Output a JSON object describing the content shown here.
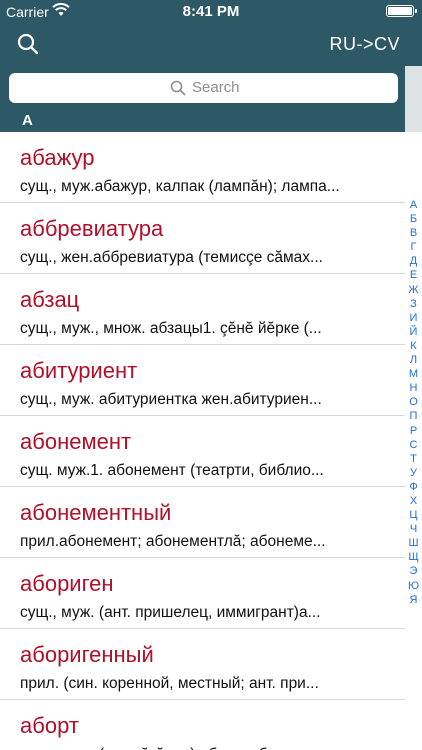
{
  "status": {
    "carrier": "Carrier",
    "time": "8:41 PM"
  },
  "nav": {
    "direction": "RU->CV"
  },
  "search": {
    "placeholder": "Search"
  },
  "section": {
    "letter": "А"
  },
  "entries": [
    {
      "word": "абажур",
      "def": "сущ., муж.абажур, калпак (лампăн); лампа..."
    },
    {
      "word": "аббревиатура",
      "def": "сущ., жен.аббревиатура (темисçе сăмах..."
    },
    {
      "word": "абзац",
      "def": "сущ., муж., множ. абзацы1. çĕнĕ йĕрке (..."
    },
    {
      "word": "абитуриент",
      "def": "сущ., муж. абитуриентка жен.абитуриен..."
    },
    {
      "word": "абонемент",
      "def": "сущ. муж.1. абонемент (театрти, библио..."
    },
    {
      "word": "абонементный",
      "def": "прил.абонемент; абонементлă; абонеме..."
    },
    {
      "word": "абориген",
      "def": "сущ., муж. (ант. пришелец, иммигрант)а..."
    },
    {
      "word": "аборигенный",
      "def": "прил. (син. коренной, местный; ант. при..."
    },
    {
      "word": "аборт",
      "def": "сущ., муж. (ача тăкăнни) аборт; аборт туни"
    }
  ],
  "index": [
    "А",
    "Б",
    "В",
    "Г",
    "Д",
    "Е",
    "Ж",
    "З",
    "И",
    "Й",
    "К",
    "Л",
    "М",
    "Н",
    "О",
    "П",
    "Р",
    "С",
    "Т",
    "У",
    "Ф",
    "Х",
    "Ц",
    "Ч",
    "Ш",
    "Щ",
    "Э",
    "Ю",
    "Я"
  ],
  "colors": {
    "bar": "#2d5866",
    "word": "#b0102a",
    "index": "#1f6fe0"
  },
  "icons": {
    "status_wifi": "wifi-icon",
    "nav_search": "search-icon",
    "battery": "battery-icon"
  }
}
